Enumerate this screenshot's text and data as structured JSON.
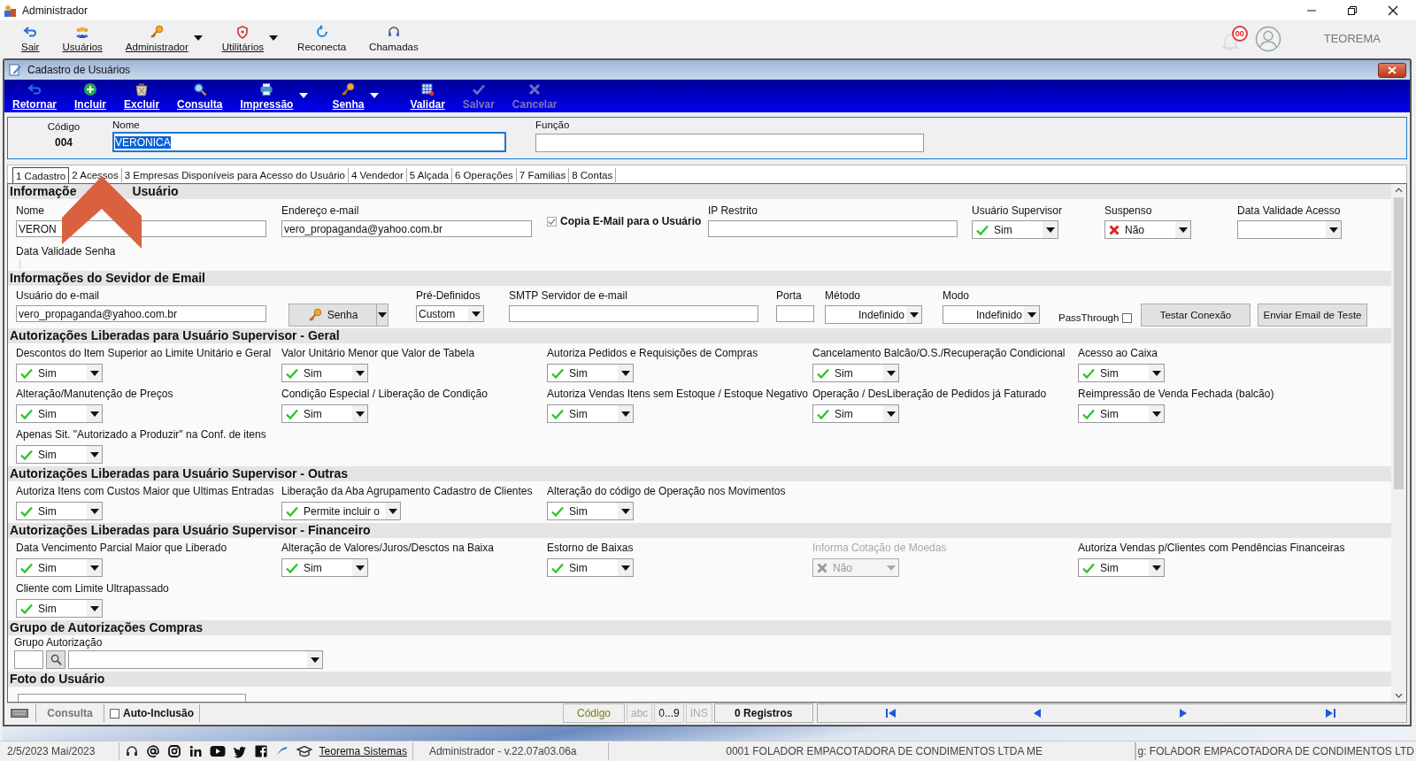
{
  "app_window": {
    "title": "Administrador"
  },
  "main_toolbar": [
    {
      "label": "Sair",
      "kind": "back",
      "dropdown": false
    },
    {
      "label": "Usuários",
      "kind": "users",
      "dropdown": false
    },
    {
      "label": "Administrador",
      "kind": "key",
      "dropdown": true
    },
    {
      "label": "Utilitários",
      "kind": "shield",
      "dropdown": true
    },
    {
      "label": "Reconecta",
      "kind": "refresh",
      "dropdown": false
    },
    {
      "label": "Chamadas",
      "kind": "headset",
      "dropdown": false
    }
  ],
  "notifications": {
    "count": "00"
  },
  "company_label": "TEOREMA",
  "form_window": {
    "title": "Cadastro de Usuários"
  },
  "form_toolbar": [
    {
      "label": "Retornar",
      "kind": "back",
      "disabled": false,
      "dropdown": false
    },
    {
      "label": "Incluir",
      "kind": "plus",
      "disabled": false,
      "dropdown": false
    },
    {
      "label": "Excluir",
      "kind": "trash",
      "disabled": false,
      "dropdown": false
    },
    {
      "label": "Consulta",
      "kind": "search",
      "disabled": false,
      "dropdown": false
    },
    {
      "label": "Impressão",
      "kind": "printer",
      "disabled": false,
      "dropdown": true
    },
    {
      "label": "Senha",
      "kind": "key",
      "disabled": false,
      "dropdown": true
    },
    {
      "label": "Validar",
      "kind": "table",
      "disabled": false,
      "dropdown": false
    },
    {
      "label": "Salvar",
      "kind": "check",
      "disabled": true,
      "dropdown": false
    },
    {
      "label": "Cancelar",
      "kind": "cross",
      "disabled": true,
      "dropdown": false
    }
  ],
  "header": {
    "code_label": "Código",
    "code": "004",
    "name_label": "Nome",
    "name": "VERONICA",
    "name_selected": true,
    "role_label": "Função"
  },
  "tabs": [
    {
      "label": "1 Cadastro",
      "selected": true
    },
    {
      "label": "2 Acessos",
      "selected": false
    },
    {
      "label": "3 Empresas Disponíveis para Acesso do Usuário",
      "selected": false
    },
    {
      "label": "4 Vendedor",
      "selected": false
    },
    {
      "label": "5 Alçada",
      "selected": false
    },
    {
      "label": "6 Operações",
      "selected": false
    },
    {
      "label": "7 Familias",
      "selected": false
    },
    {
      "label": "8 Contas",
      "selected": false
    }
  ],
  "user_info": {
    "title_parts": [
      "Informaçõe",
      "Usuário"
    ],
    "name_label": "Nome",
    "name": "VERON",
    "email_label": "Endereço e-mail",
    "email": "vero_propaganda@yahoo.com.br",
    "copy_email": {
      "label": "Copia E-Mail para o Usuário",
      "checked": true
    },
    "ip_label": "IP Restrito",
    "supervisor": {
      "label": "Usuário Supervisor",
      "value": "Sim",
      "allowed": true
    },
    "suspended": {
      "label": "Suspenso",
      "value": "Não",
      "allowed": false
    },
    "access_expiry_label": "Data Validade Acesso",
    "password_expiry_label": "Data Validade Senha"
  },
  "email_server": {
    "title": "Informações do Sevidor de Email",
    "user_label": "Usuário do e-mail",
    "user": "vero_propaganda@yahoo.com.br",
    "password_button": "Senha",
    "preset_label": "Pré-Definidos",
    "preset": "Custom",
    "smtp_label": "SMTP Servidor de e-mail",
    "port_label": "Porta",
    "method_label": "Método",
    "method": "Indefinido",
    "mode_label": "Modo",
    "mode": "Indefinido",
    "passthrough": {
      "label": "PassThrough",
      "checked": false
    },
    "buttons": [
      "Testar Conexão",
      "Enviar Email de Teste"
    ]
  },
  "auth_sections": [
    {
      "title": "Autorizações Liberadas para Usuário Supervisor - Geral",
      "items": [
        {
          "label": "Descontos do Item Superior ao Limite Unitário e Geral",
          "value": "Sim",
          "allowed": true,
          "disabled": false
        },
        {
          "label": "Valor Unitário Menor que Valor de Tabela",
          "value": "Sim",
          "allowed": true,
          "disabled": false
        },
        {
          "label": "Autoriza Pedidos e Requisições de Compras",
          "value": "Sim",
          "allowed": true,
          "disabled": false
        },
        {
          "label": "Cancelamento Balcão/O.S./Recuperação Condicional",
          "value": "Sim",
          "allowed": true,
          "disabled": false
        },
        {
          "label": "Acesso ao Caixa",
          "value": "Sim",
          "allowed": true,
          "disabled": false
        },
        {
          "label": "Alteração/Manutenção de Preços",
          "value": "Sim",
          "allowed": true,
          "disabled": false
        },
        {
          "label": "Condição Especial / Liberação de Condição",
          "value": "Sim",
          "allowed": true,
          "disabled": false
        },
        {
          "label": "Autoriza Vendas Itens sem Estoque / Estoque Negativo",
          "value": "Sim",
          "allowed": true,
          "disabled": false
        },
        {
          "label": "Operação / DesLiberação de Pedidos já Faturado",
          "value": "Sim",
          "allowed": true,
          "disabled": false
        },
        {
          "label": "Reimpressão de Venda Fechada (balcão)",
          "value": "Sim",
          "allowed": true,
          "disabled": false
        },
        {
          "label": "Apenas Sit. \"Autorizado a Produzir\" na Conf. de itens",
          "value": "Sim",
          "allowed": true,
          "disabled": false
        }
      ]
    },
    {
      "title": "Autorizações Liberadas para Usuário Supervisor - Outras",
      "items": [
        {
          "label": "Autoriza Itens com Custos Maior que Ultimas Entradas",
          "value": "Sim",
          "allowed": true,
          "disabled": false
        },
        {
          "label": "Liberação da Aba Agrupamento Cadastro de Clientes",
          "value": "Permite incluir o",
          "allowed": true,
          "disabled": false
        },
        {
          "label": "Alteração do código de Operação nos Movimentos",
          "value": "Sim",
          "allowed": true,
          "disabled": false
        }
      ]
    },
    {
      "title": "Autorizações Liberadas para Usuário Supervisor - Financeiro",
      "items": [
        {
          "label": "Data Vencimento Parcial Maior que Liberado",
          "value": "Sim",
          "allowed": true,
          "disabled": false
        },
        {
          "label": "Alteração de Valores/Juros/Desctos na Baixa",
          "value": "Sim",
          "allowed": true,
          "disabled": false
        },
        {
          "label": "Estorno de Baixas",
          "value": "Sim",
          "allowed": true,
          "disabled": false
        },
        {
          "label": "Informa Cotação de Moedas",
          "value": "Não",
          "allowed": false,
          "disabled": true
        },
        {
          "label": "Autoriza Vendas p/Clientes com Pendências Financeiras",
          "value": "Sim",
          "allowed": true,
          "disabled": false
        },
        {
          "label": "Cliente com Limite Ultrapassado",
          "value": "Sim",
          "allowed": true,
          "disabled": false
        }
      ]
    }
  ],
  "purchase_group": {
    "title": "Grupo de Autorizações Compras",
    "label": "Grupo Autorização"
  },
  "photo": {
    "title": "Foto do Usuário"
  },
  "nav_bar": {
    "mode": "Consulta",
    "auto_include": {
      "label": "Auto-Inclusão",
      "checked": false
    },
    "key_field": "Código",
    "indicators": [
      {
        "label": "abc",
        "on": false
      },
      {
        "label": "0...9",
        "on": true
      },
      {
        "label": "INS",
        "on": false
      }
    ],
    "records": "0 Registros"
  },
  "status_bar": {
    "date": "2/5/2023 Mai/2023",
    "link": "Teorema Sistemas",
    "user_version": "Administrador - v.22.07a03.06a",
    "company": "0001 FOLADOR EMPACOTADORA DE CONDIMENTOS LTDA ME",
    "company_right": "g: FOLADOR EMPACOTADORA DE CONDIMENTOS LTD"
  }
}
